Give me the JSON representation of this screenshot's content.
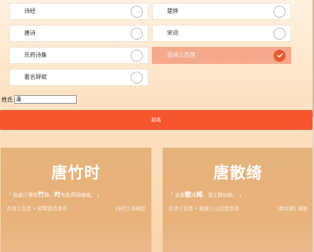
{
  "options": [
    {
      "label": "诗经",
      "selected": false
    },
    {
      "label": "楚辞",
      "selected": false
    },
    {
      "label": "唐诗",
      "selected": false
    },
    {
      "label": "宋词",
      "selected": false
    },
    {
      "label": "乐府诗集",
      "selected": false
    },
    {
      "label": "古诗三百首",
      "selected": true
    },
    {
      "label": "著名辞赋",
      "selected": false
    }
  ],
  "form": {
    "surname_label": "姓氏",
    "surname_value": "唐",
    "submit_label": "起名"
  },
  "cards": [
    {
      "name": "唐竹时",
      "quote_parts": [
        "「 窃虚日薄花",
        "竹",
        "静，",
        "时",
        "有乳燕相哺哺。 」"
      ],
      "source": "古诗三百首 • 初晴游沧浪亭",
      "author": "[宋代] 苏舜钦"
    },
    {
      "name": "唐散绮",
      "quote_parts": [
        "「 余霞",
        "散",
        "成",
        "绮",
        "，澄江静如练。 」"
      ],
      "source": "古诗三百首 • 晚登三山还望京邑",
      "author": "[南北朝] 谢朓"
    }
  ],
  "colors": {
    "accent": "#f7552e",
    "selected_tile": "#f4a98c",
    "card": "#e6b37a"
  },
  "icons": {
    "check": "check-icon"
  }
}
